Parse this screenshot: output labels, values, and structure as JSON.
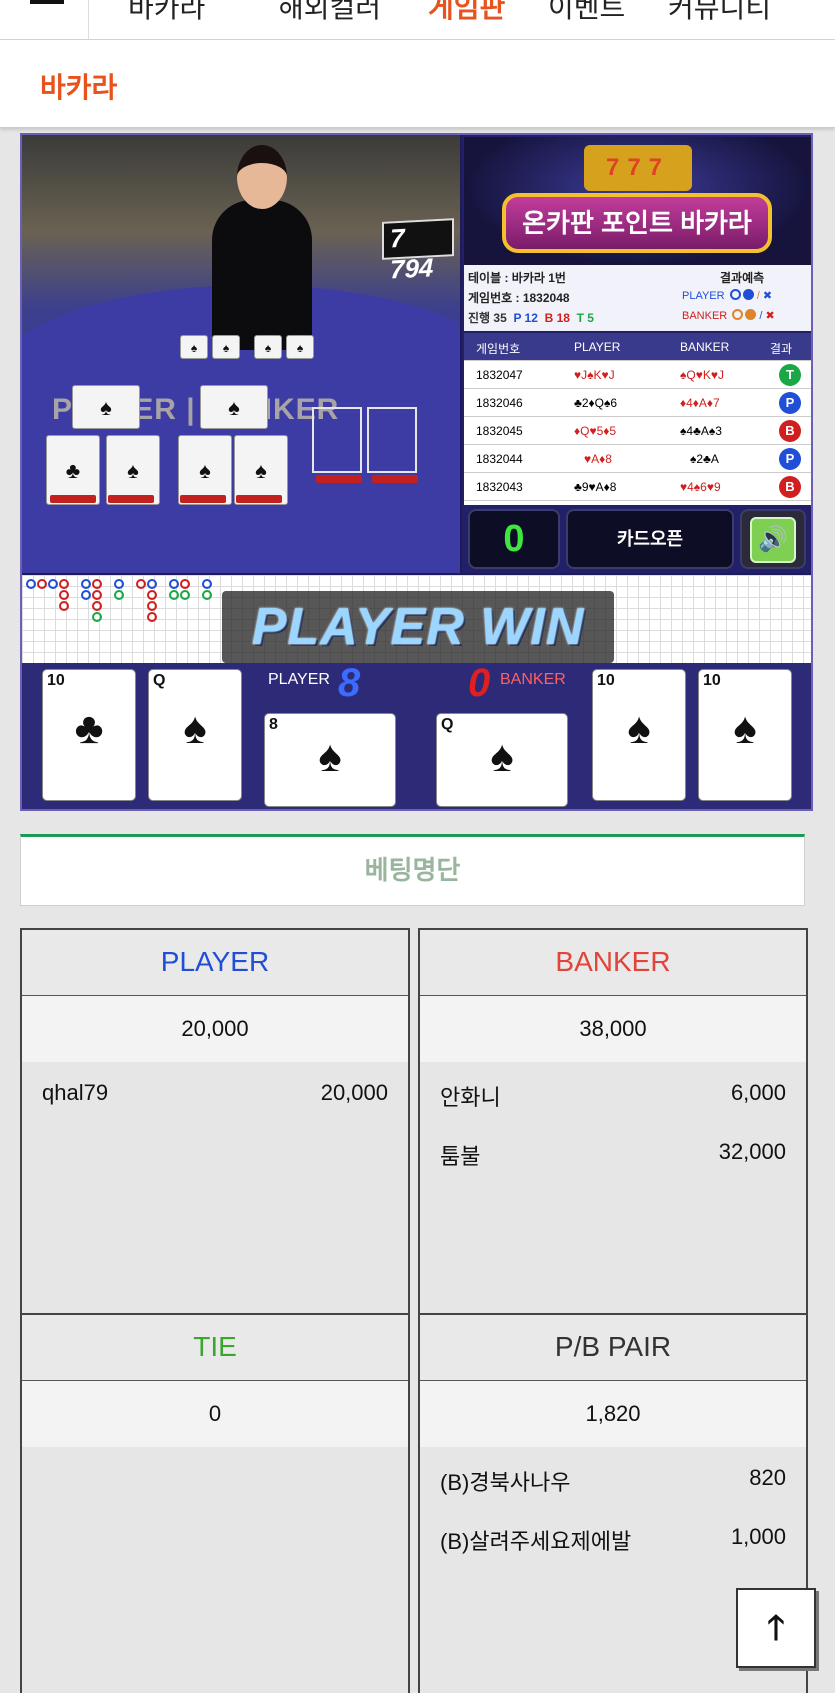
{
  "nav": {
    "items": [
      "바카라",
      "해외컬러",
      "게임판",
      "이벤트",
      "커뮤니티"
    ]
  },
  "page": {
    "title": "바카라"
  },
  "game": {
    "video_number": "7 794",
    "video_player_label": "PLAYER",
    "video_banker_label": "BANKER",
    "banner_title": "온카판 포인트 바카라",
    "banner_slot": "777",
    "info": {
      "table": "테이블 : 바카라 1번",
      "prediction": "결과예측",
      "game_no": "게임번호 : 1832048",
      "progress_label": "진행 35",
      "p_count": "P 12",
      "b_count": "B 18",
      "t_count": "T 5",
      "player_label": "PLAYER",
      "banker_label": "BANKER"
    },
    "history": {
      "headers": [
        "게임번호",
        "PLAYER",
        "BANKER",
        "결과"
      ],
      "rows": [
        {
          "no": "1832047",
          "player": "♥J♠K♥J",
          "banker": "♠Q♥K♥J",
          "result": "T"
        },
        {
          "no": "1832046",
          "player": "♣2♦Q♠6",
          "banker": "♦4♦A♦7",
          "result": "P"
        },
        {
          "no": "1832045",
          "player": "♦Q♥5♦5",
          "banker": "♠4♣A♠3",
          "result": "B"
        },
        {
          "no": "1832044",
          "player": "♥A♦8",
          "banker": "♠2♣A",
          "result": "P"
        },
        {
          "no": "1832043",
          "player": "♣9♥A♦8",
          "banker": "♥4♠6♥9",
          "result": "B"
        }
      ]
    },
    "countdown": "0",
    "card_open": "카드오픈",
    "win_text": "PLAYER WIN",
    "player_score_label": "PLAYER",
    "player_score": "8",
    "banker_score_label": "BANKER",
    "banker_score": "0",
    "player_cards": [
      {
        "rank": "10",
        "suit": "♣"
      },
      {
        "rank": "Q",
        "suit": "♠"
      },
      {
        "rank": "8",
        "suit": "♠"
      }
    ],
    "banker_cards": [
      {
        "rank": "Q",
        "suit": "♠"
      },
      {
        "rank": "10",
        "suit": "♠"
      },
      {
        "rank": "10",
        "suit": "♠"
      }
    ]
  },
  "bets": {
    "section_title": "베팅명단",
    "player": {
      "label": "PLAYER",
      "color": "#1f4fd6",
      "total": "20,000",
      "entries": [
        {
          "name": "qhal79",
          "amount": "20,000"
        }
      ]
    },
    "banker": {
      "label": "BANKER",
      "color": "#e0443a",
      "total": "38,000",
      "entries": [
        {
          "name": "안화니",
          "amount": "6,000"
        },
        {
          "name": "툼불",
          "amount": "32,000"
        }
      ]
    },
    "tie": {
      "label": "TIE",
      "color": "#3aa62e",
      "total": "0",
      "entries": []
    },
    "pair": {
      "label": "P/B PAIR",
      "color": "#333333",
      "total": "1,820",
      "entries": [
        {
          "name": "(B)경북사나우",
          "amount": "820"
        },
        {
          "name": "(B)살려주세요제에발",
          "amount": "1,000"
        }
      ]
    }
  },
  "icons": {
    "menu": "hamburger-icon",
    "sound": "speaker-icon",
    "scroll_top": "arrow-up-icon"
  }
}
